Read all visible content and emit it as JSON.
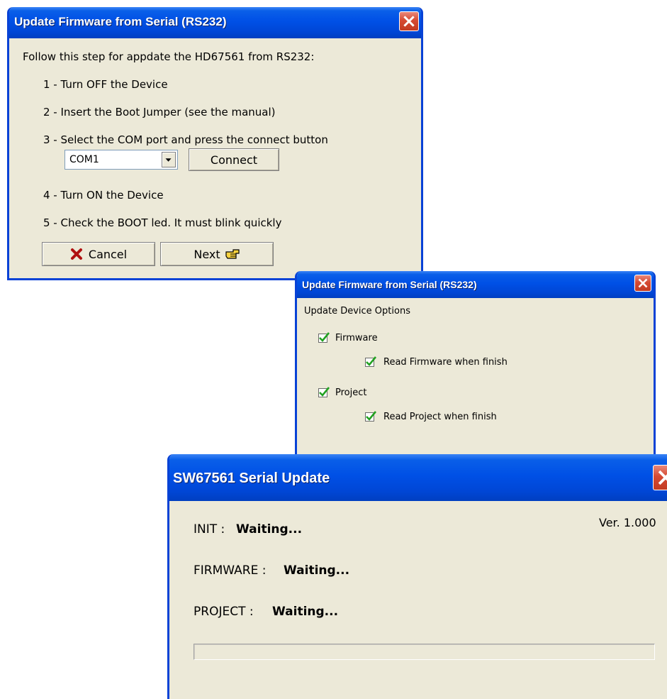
{
  "dialog1": {
    "title": "Update Firmware from Serial (RS232)",
    "intro": "Follow this step for appdate the HD67561 from RS232:",
    "steps": [
      "1 - Turn OFF the Device",
      "2 - Insert the Boot Jumper (see the manual)",
      "3 - Select the  COM port and press the connect button",
      "4 - Turn ON the Device",
      "5 - Check the BOOT led. It must blink quickly"
    ],
    "com_port_value": "COM1",
    "connect_label": "Connect",
    "cancel_label": "Cancel",
    "next_label": "Next"
  },
  "dialog2": {
    "title": "Update Firmware from Serial (RS232)",
    "section_label": "Update Device Options",
    "options": [
      {
        "label": "Firmware",
        "checked": true
      },
      {
        "label": "Read Firmware when finish",
        "checked": true
      },
      {
        "label": "Project",
        "checked": true
      },
      {
        "label": "Read Project when finish",
        "checked": true
      }
    ]
  },
  "dialog3": {
    "title": "SW67561 Serial Update",
    "version": "Ver. 1.000",
    "rows": [
      {
        "label": "INIT :",
        "status": "Waiting..."
      },
      {
        "label": "FIRMWARE :",
        "status": "Waiting..."
      },
      {
        "label": "PROJECT :",
        "status": "Waiting..."
      }
    ],
    "progress": 0
  },
  "colors": {
    "title_blue": "#0050e6",
    "window_face": "#ece9d8",
    "close_red": "#d64a33",
    "check_green": "#21a121"
  }
}
